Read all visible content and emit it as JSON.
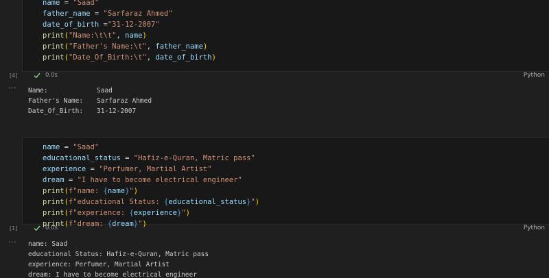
{
  "cell1": {
    "execution_count": "[4]",
    "exec_time": "0.0s",
    "language": "Python",
    "code": [
      [
        {
          "t": "var",
          "v": "name"
        },
        {
          "t": "op",
          "v": " = "
        },
        {
          "t": "str",
          "v": "\"Saad\""
        }
      ],
      [
        {
          "t": "var",
          "v": "father_name"
        },
        {
          "t": "op",
          "v": " = "
        },
        {
          "t": "str",
          "v": "\"Sarfaraz Ahmed\""
        }
      ],
      [
        {
          "t": "var",
          "v": "date_of_birth"
        },
        {
          "t": "op",
          "v": " ="
        },
        {
          "t": "str",
          "v": "\"31-12-2007\""
        }
      ],
      [
        {
          "t": "fn",
          "v": "print"
        },
        {
          "t": "pun",
          "v": "("
        },
        {
          "t": "str",
          "v": "\"Name:\\t\\t\""
        },
        {
          "t": "op",
          "v": ", "
        },
        {
          "t": "var",
          "v": "name"
        },
        {
          "t": "pun",
          "v": ")"
        }
      ],
      [
        {
          "t": "fn",
          "v": "print"
        },
        {
          "t": "pun",
          "v": "("
        },
        {
          "t": "str",
          "v": "\"Father's Name:\\t\""
        },
        {
          "t": "op",
          "v": ", "
        },
        {
          "t": "var",
          "v": "father_name"
        },
        {
          "t": "pun",
          "v": ")"
        }
      ],
      [
        {
          "t": "fn",
          "v": "print"
        },
        {
          "t": "pun",
          "v": "("
        },
        {
          "t": "str",
          "v": "\"Date_Of_Birth:\\t\""
        },
        {
          "t": "op",
          "v": ", "
        },
        {
          "t": "var",
          "v": "date_of_birth"
        },
        {
          "t": "pun",
          "v": ")"
        }
      ]
    ],
    "output": [
      {
        "label": "Name:",
        "value": "Saad"
      },
      {
        "label": "Father's Name:",
        "value": "Sarfaraz Ahmed"
      },
      {
        "label": "Date_Of_Birth:",
        "value": "31-12-2007"
      }
    ]
  },
  "cell2": {
    "execution_count": "[1]",
    "exec_time": "0.0s",
    "language": "Python",
    "code": [
      [
        {
          "t": "var",
          "v": "name"
        },
        {
          "t": "op",
          "v": " = "
        },
        {
          "t": "str",
          "v": "\"Saad\""
        }
      ],
      [
        {
          "t": "var",
          "v": "educational_status"
        },
        {
          "t": "op",
          "v": " = "
        },
        {
          "t": "str",
          "v": "\"Hafiz-e-Quran, Matric pass\""
        }
      ],
      [
        {
          "t": "var",
          "v": "experience"
        },
        {
          "t": "op",
          "v": " = "
        },
        {
          "t": "str",
          "v": "\"Perfumer, Martial Artist\""
        }
      ],
      [
        {
          "t": "var",
          "v": "dream"
        },
        {
          "t": "op",
          "v": " = "
        },
        {
          "t": "str",
          "v": "\"I have to become electrical engineer\""
        }
      ],
      [
        {
          "t": "fn",
          "v": "print"
        },
        {
          "t": "pun",
          "v": "("
        },
        {
          "t": "str",
          "v": "f\"name: "
        },
        {
          "t": "brace",
          "v": "{"
        },
        {
          "t": "var",
          "v": "name"
        },
        {
          "t": "brace",
          "v": "}"
        },
        {
          "t": "str",
          "v": "\""
        },
        {
          "t": "pun",
          "v": ")"
        }
      ],
      [
        {
          "t": "fn",
          "v": "print"
        },
        {
          "t": "pun",
          "v": "("
        },
        {
          "t": "str",
          "v": "f\"educational Status: "
        },
        {
          "t": "brace",
          "v": "{"
        },
        {
          "t": "var",
          "v": "educational_status"
        },
        {
          "t": "brace",
          "v": "}"
        },
        {
          "t": "str",
          "v": "\""
        },
        {
          "t": "pun",
          "v": ")"
        }
      ],
      [
        {
          "t": "fn",
          "v": "print"
        },
        {
          "t": "pun",
          "v": "("
        },
        {
          "t": "str",
          "v": "f\"experience: "
        },
        {
          "t": "brace",
          "v": "{"
        },
        {
          "t": "var",
          "v": "experience"
        },
        {
          "t": "brace",
          "v": "}"
        },
        {
          "t": "str",
          "v": "\""
        },
        {
          "t": "pun",
          "v": ")"
        }
      ],
      [
        {
          "t": "fn",
          "v": "print"
        },
        {
          "t": "pun",
          "v": "("
        },
        {
          "t": "str",
          "v": "f\"dream: "
        },
        {
          "t": "brace",
          "v": "{"
        },
        {
          "t": "var",
          "v": "dream"
        },
        {
          "t": "brace",
          "v": "}"
        },
        {
          "t": "str",
          "v": "\""
        },
        {
          "t": "pun",
          "v": ")"
        }
      ]
    ],
    "output": [
      "name: Saad",
      "educational Status: Hafiz-e-Quran, Matric pass",
      "experience: Perfumer, Martial Artist",
      "dream: I have to become electrical engineer"
    ]
  },
  "icons": {
    "check": "check-icon",
    "more": "more-icon",
    "more_glyph": "···"
  },
  "colors": {
    "success_check": "#89d185"
  }
}
